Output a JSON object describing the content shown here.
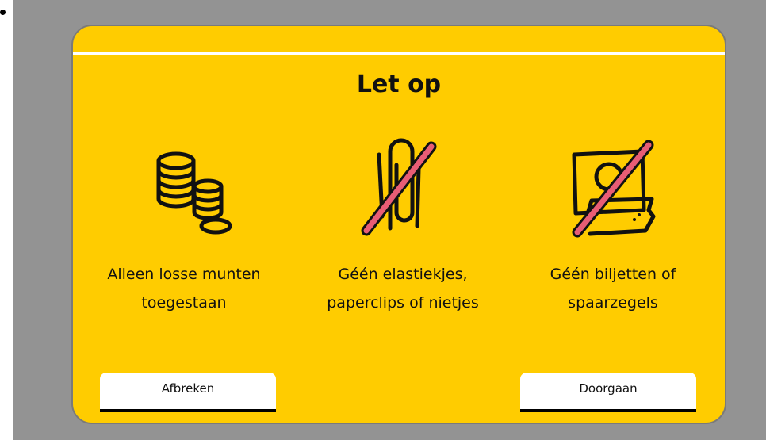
{
  "dialog": {
    "title": "Let op",
    "items": [
      {
        "icon": "coins-icon",
        "line1": "Alleen losse munten",
        "line2": "toegestaan"
      },
      {
        "icon": "no-paperclip-icon",
        "line1": "Géén elastiekjes,",
        "line2": "paperclips of nietjes"
      },
      {
        "icon": "no-banknotes-icon",
        "line1": "Géén biljetten of",
        "line2": "spaarzegels"
      }
    ],
    "cancel_label": "Afbreken",
    "continue_label": "Doorgaan"
  },
  "colors": {
    "background": "#939393",
    "dialog": "#ffcc00",
    "strike": "#e85d75",
    "ink": "#111111"
  }
}
